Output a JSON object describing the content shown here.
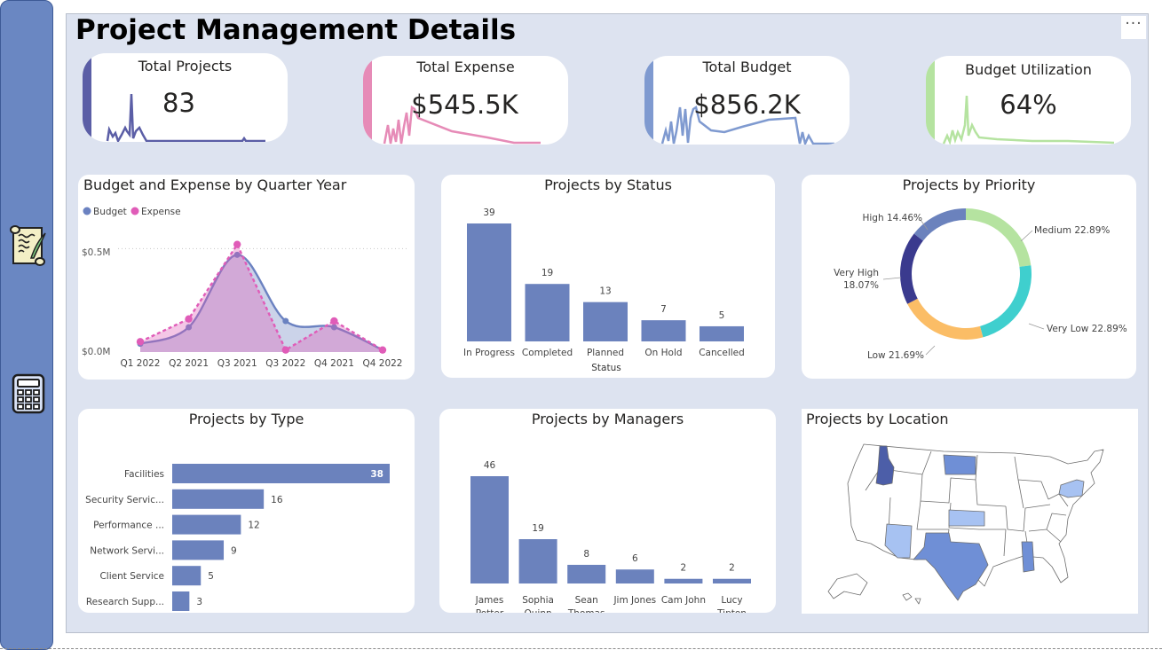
{
  "page": {
    "title": "Project Management Details",
    "more_label": "···"
  },
  "nav": {
    "items": [
      {
        "icon": "scroll-quill-icon"
      },
      {
        "icon": "calculator-icon"
      }
    ]
  },
  "kpis": {
    "total_projects": {
      "label": "Total Projects",
      "value": "83",
      "color": "#5b5ea6"
    },
    "total_expense": {
      "label": "Total Expense",
      "value": "$545.5K",
      "color": "#e68bb7"
    },
    "total_budget": {
      "label": "Total Budget",
      "value": "$856.2K",
      "color": "#7f9ad0"
    },
    "budget_utilization": {
      "label": "Budget Utilization",
      "value": "64%",
      "color": "#b5e3a0"
    }
  },
  "budget_expense": {
    "title": "Budget and Expense by Quarter Year",
    "legend": [
      {
        "name": "Budget",
        "color": "#6b82c1"
      },
      {
        "name": "Expense",
        "color": "#e05cb8"
      }
    ],
    "y_ticks": [
      "$0.5M",
      "$0.0M"
    ]
  },
  "status": {
    "title": "Projects by Status",
    "xlabel": "Status"
  },
  "priority": {
    "title": "Projects by Priority"
  },
  "type": {
    "title": "Projects by Type"
  },
  "managers": {
    "title": "Projects by Managers"
  },
  "location": {
    "title": "Projects by Location"
  },
  "chart_data": [
    {
      "id": "budget_expense",
      "type": "area",
      "title": "Budget and Expense by Quarter Year",
      "categories": [
        "Q1 2022",
        "Q2 2021",
        "Q3 2021",
        "Q3 2022",
        "Q4 2021",
        "Q4 2022"
      ],
      "series": [
        {
          "name": "Budget",
          "values": [
            0.04,
            0.12,
            0.47,
            0.15,
            0.12,
            0.01
          ]
        },
        {
          "name": "Expense",
          "values": [
            0.05,
            0.16,
            0.52,
            0.01,
            0.15,
            0.01
          ]
        }
      ],
      "y_tick_values": [
        0.5,
        0
      ],
      "ylim": [
        0,
        0.6
      ],
      "legend_position": "top-left"
    },
    {
      "id": "status",
      "type": "bar",
      "title": "Projects by Status",
      "xlabel": "Status",
      "categories": [
        "In Progress",
        "Completed",
        "Planned",
        "On Hold",
        "Cancelled"
      ],
      "values": [
        39,
        19,
        13,
        7,
        5
      ],
      "color": "#6b82bd"
    },
    {
      "id": "priority",
      "type": "pie",
      "title": "Projects by Priority",
      "donut": true,
      "slices": [
        {
          "name": "Medium",
          "value": 22.89,
          "label": "Medium 22.89%",
          "color": "#b5e3a0"
        },
        {
          "name": "Very Low",
          "value": 22.89,
          "label": "Very Low 22.89%",
          "color": "#3fcfce"
        },
        {
          "name": "Low",
          "value": 21.69,
          "label": "Low 21.69%",
          "color": "#fbbd66"
        },
        {
          "name": "Very High",
          "value": 18.07,
          "label": "Very High",
          "label2": "18.07%",
          "color": "#3a3a8e"
        },
        {
          "name": "High",
          "value": 14.46,
          "label": "High 14.46%",
          "color": "#6b82bd"
        }
      ]
    },
    {
      "id": "type",
      "type": "bar",
      "orientation": "horizontal",
      "title": "Projects by Type",
      "categories": [
        "Facilities",
        "Security Servic...",
        "Performance ...",
        "Network Servi...",
        "Client Service",
        "Research Supp..."
      ],
      "values": [
        38,
        16,
        12,
        9,
        5,
        3
      ],
      "color": "#6b82bd"
    },
    {
      "id": "managers",
      "type": "bar",
      "title": "Projects by Managers",
      "categories": [
        [
          "James",
          "Potter"
        ],
        [
          "Sophia",
          "Quinn"
        ],
        [
          "Sean",
          "Thomas"
        ],
        [
          "Jim Jones"
        ],
        [
          "Cam John"
        ],
        [
          "Lucy",
          "Tipton"
        ]
      ],
      "values": [
        46,
        19,
        8,
        6,
        2,
        2
      ],
      "color": "#6b82bd"
    }
  ]
}
